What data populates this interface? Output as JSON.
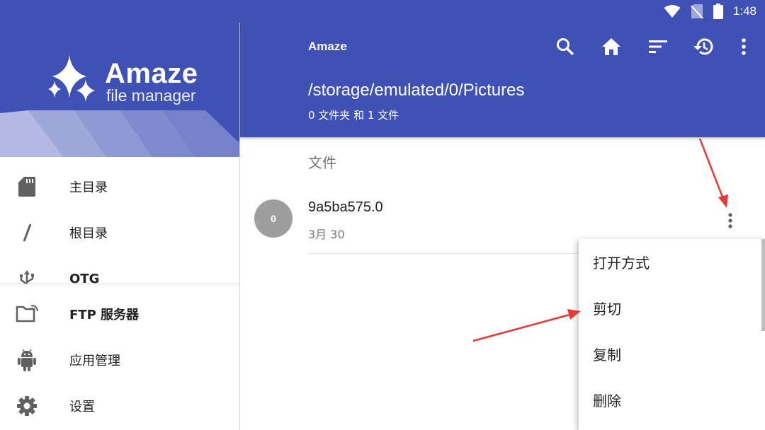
{
  "status_bar": {
    "time": "1:48",
    "icons": [
      "wifi-icon",
      "no-sim-icon",
      "battery-icon"
    ]
  },
  "drawer": {
    "brand_title": "Amaze",
    "brand_subtitle": "file manager",
    "items": [
      {
        "label": "主目录",
        "icon": "sd-card-icon"
      },
      {
        "label": "根目录",
        "icon": "slash-icon"
      },
      {
        "label": "OTG",
        "icon": "usb-icon"
      },
      {
        "label": "FTP 服务器",
        "icon": "ftp-folder-icon"
      },
      {
        "label": "应用管理",
        "icon": "android-icon"
      },
      {
        "label": "设置",
        "icon": "gear-icon"
      }
    ]
  },
  "toolbar": {
    "title": "Amaze",
    "actions": [
      "search-icon",
      "home-icon",
      "sort-icon",
      "history-icon",
      "more-vert-icon"
    ],
    "path": "/storage/emulated/0/Pictures",
    "summary": "0 文件夹 和 1 文件"
  },
  "content": {
    "section_header": "文件",
    "files": [
      {
        "avatar_text": "0",
        "name": "9a5ba575.0",
        "date": "3月 30"
      }
    ]
  },
  "popup_menu": {
    "items": [
      "打开方式",
      "剪切",
      "复制",
      "删除"
    ]
  },
  "colors": {
    "primary": "#3f51b5",
    "annotation": "#e53935",
    "avatar": "#9e9e9e"
  }
}
